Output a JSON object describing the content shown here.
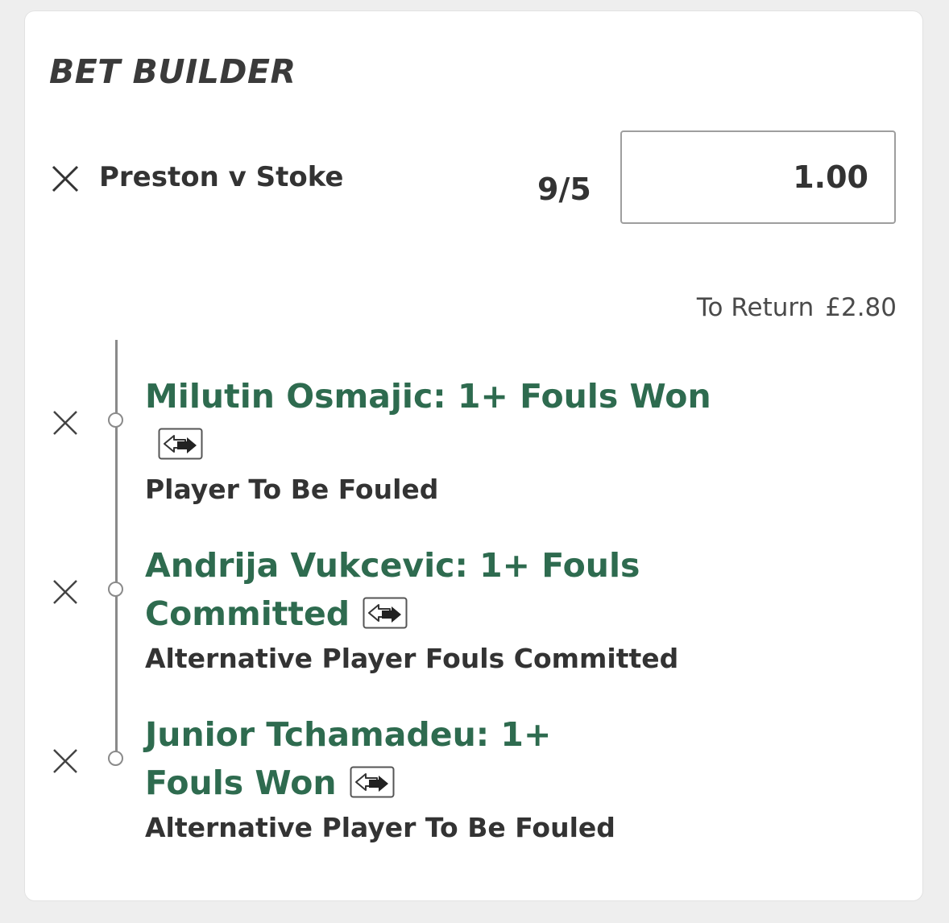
{
  "bet_builder": {
    "title": "BET BUILDER",
    "event": "Preston v Stoke",
    "odds": "9/5",
    "stake": "1.00",
    "to_return_label": "To Return",
    "to_return_amount": "£2.80"
  },
  "legs": [
    {
      "selection": "Milutin Osmajic: 1+ Fouls Won",
      "market": "Player To Be Fouled"
    },
    {
      "selection": "Andrija Vukcevic: 1+ Fouls Committed",
      "market": "Alternative Player Fouls Committed"
    },
    {
      "selection": "Junior Tchamadeu: 1+ Fouls Won",
      "market": "Alternative Player To Be Fouled"
    }
  ],
  "colors": {
    "accent_green": "#2e6b4f",
    "text_dark": "#333333",
    "border_gray": "#9e9e9e",
    "background": "#eeeeee"
  },
  "icons": {
    "remove": "close-icon",
    "swap": "swap-icon"
  }
}
